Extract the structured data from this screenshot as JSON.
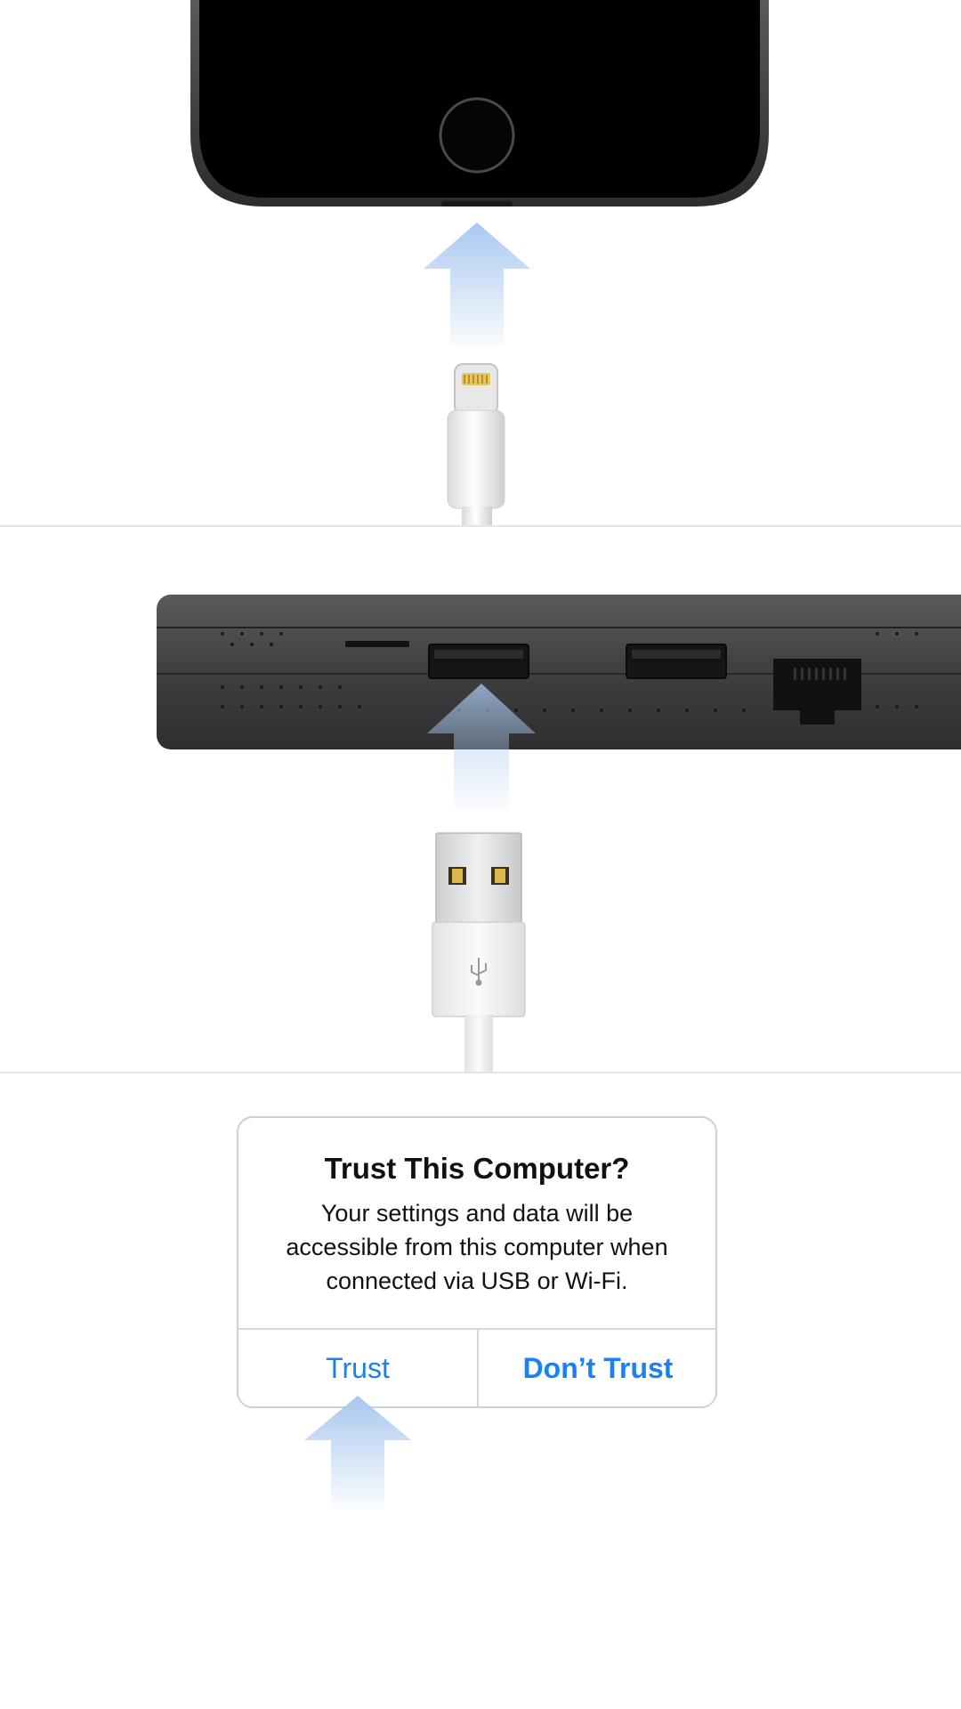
{
  "dialog": {
    "title": "Trust This Computer?",
    "message": "Your settings and data will be accessible from this computer when connected via USB or Wi-Fi.",
    "trust_label": "Trust",
    "dont_trust_label": "Don’t Trust"
  },
  "colors": {
    "accent": "#1a82f0",
    "arrow": "#a9c8ef",
    "hub_body": "#404040",
    "phone_frame": "#3b3b3d"
  },
  "icons": {
    "usb_symbol": "usb-icon",
    "arrows": "arrow-up-icon"
  }
}
